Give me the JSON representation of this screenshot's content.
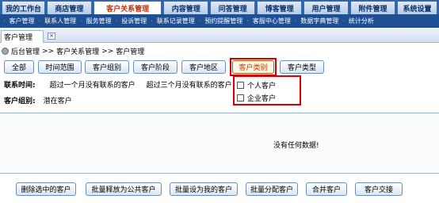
{
  "top_tabs": [
    "我的工作台",
    "商店管理",
    "客户关系管理",
    "内容管理",
    "问答管理",
    "博客管理",
    "用户管理",
    "附件管理",
    "系统设置"
  ],
  "sub_nav": [
    "客户管理",
    "联系人管理",
    "服务管理",
    "投诉管理",
    "联系记录管理",
    "预约提醒管理",
    "客服中心管理",
    "数据字典管理",
    "统计分析"
  ],
  "page_tab": {
    "label": "客户管理"
  },
  "breadcrumb": {
    "root": "后台管理",
    "sep1": ">>",
    "section": "客户关系管理",
    "sep2": ">>",
    "current": "客户管理"
  },
  "filters": [
    "全部",
    "时间范围",
    "客户组别",
    "客户阶段",
    "客户地区",
    "客户类别",
    "客户类型"
  ],
  "active_filter": "客户类别",
  "contact_row": {
    "label": "联系时间:",
    "opt1": "超过一个月没有联系的客户",
    "opt2": "超过三个月没有联系的客户"
  },
  "group_row": {
    "label": "客户组别:",
    "value": "潜在客户"
  },
  "dropdown": {
    "options": [
      "个人客户",
      "企业客户"
    ]
  },
  "table": {
    "empty_text": "没有任何数据!"
  },
  "actions": [
    "删除选中的客户",
    "批量释放为公共客户",
    "批量设为我的客户",
    "批量分配客户",
    "合并客户",
    "客户交接"
  ],
  "colors": {
    "nav_bg": "#2f64a8",
    "subnav_bg": "#1e4f93",
    "highlight": "#d40000"
  }
}
